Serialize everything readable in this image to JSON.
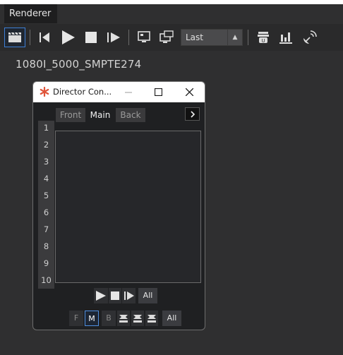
{
  "window": {
    "tab_title": "Renderer"
  },
  "toolbar": {
    "icons": [
      "clapperboard-icon",
      "skip-to-start-icon",
      "play-icon",
      "stop-icon",
      "continue-icon",
      "monitor-icon",
      "external-monitor-icon",
      "layer-icon",
      "bar-chart-icon",
      "satellite-icon"
    ],
    "mode_select": {
      "value": "Last"
    }
  },
  "scene": {
    "name": "1080I_5000_SMPTE274"
  },
  "director_control": {
    "title": "Director Con...",
    "tabs": [
      "Front",
      "Main",
      "Back"
    ],
    "active_tab": "Main",
    "row_numbers": [
      "1",
      "2",
      "3",
      "4",
      "5",
      "6",
      "7",
      "8",
      "9",
      "10"
    ],
    "all_label_1": "All",
    "layer_buttons": [
      "F",
      "M",
      "B"
    ],
    "active_layer": "M",
    "all_label_2": "All"
  },
  "colors": {
    "accent": "#3d7fd6",
    "panel": "#2f2f30",
    "dialog": "#1f2022"
  }
}
